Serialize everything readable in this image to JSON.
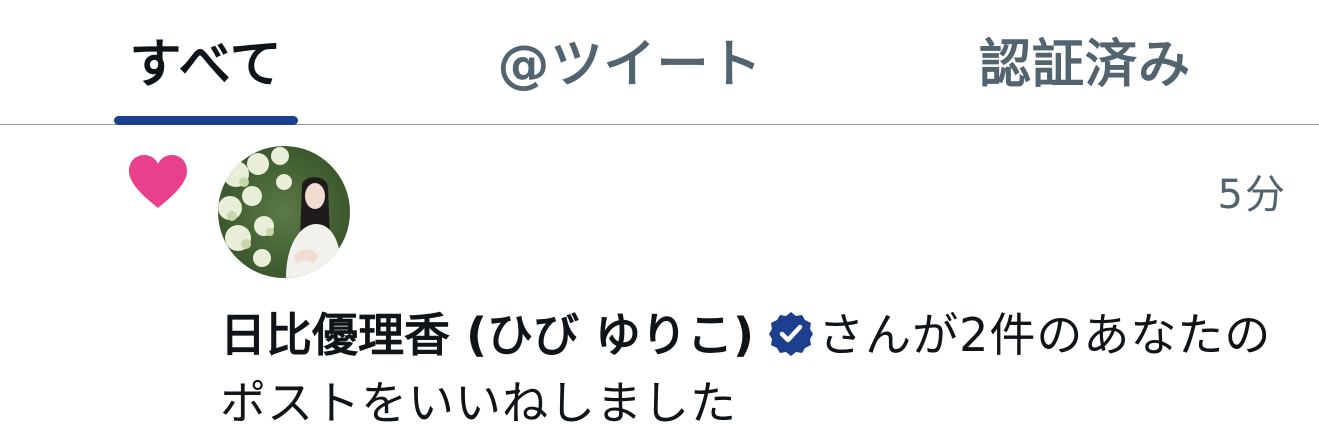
{
  "tabs": [
    {
      "label": "すべて",
      "active": true
    },
    {
      "label": "@ツイート",
      "active": false
    },
    {
      "label": "認証済み",
      "active": false
    }
  ],
  "notification": {
    "type_icon": "heart-icon",
    "timestamp": "5分",
    "user_name": "日比優理香 (ひび ゆりこ)",
    "verified": true,
    "message": "さんが2件のあなたのポストをいいねしました"
  },
  "colors": {
    "accent": "#1d3f8f",
    "heart": "#e8408a",
    "secondary_text": "#536471"
  }
}
